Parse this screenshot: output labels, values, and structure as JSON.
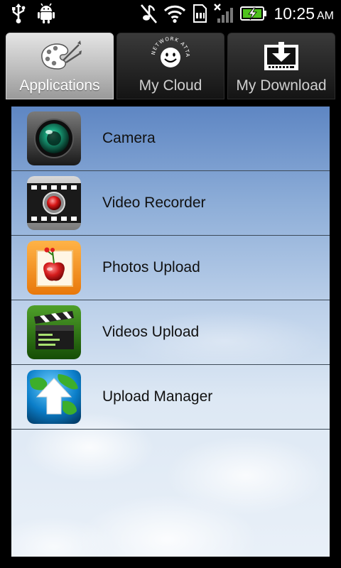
{
  "status_bar": {
    "time": "10:25",
    "ampm": "AM",
    "icons": [
      "usb-icon",
      "android-debug-icon",
      "mute-icon",
      "wifi-icon",
      "sd-card-icon",
      "no-signal-icon",
      "battery-charging-icon"
    ]
  },
  "tabs": [
    {
      "label": "Applications",
      "icon": "palette-icon",
      "active": true
    },
    {
      "label": "My Cloud",
      "icon": "smiley-cloud-icon",
      "icon_caption": "NETWORK ATTACHED",
      "active": false
    },
    {
      "label": "My Download",
      "icon": "download-tray-icon",
      "active": false
    }
  ],
  "apps": [
    {
      "label": "Camera",
      "icon": "camera-lens-icon"
    },
    {
      "label": "Video Recorder",
      "icon": "video-recorder-icon"
    },
    {
      "label": "Photos Upload",
      "icon": "photo-apple-icon"
    },
    {
      "label": "Videos Upload",
      "icon": "clapperboard-icon"
    },
    {
      "label": "Upload Manager",
      "icon": "globe-upload-icon"
    }
  ],
  "colors": {
    "sky_top": "#5e86c3",
    "sky_bottom": "#e9f0f8",
    "divider": "#3d4a58"
  }
}
